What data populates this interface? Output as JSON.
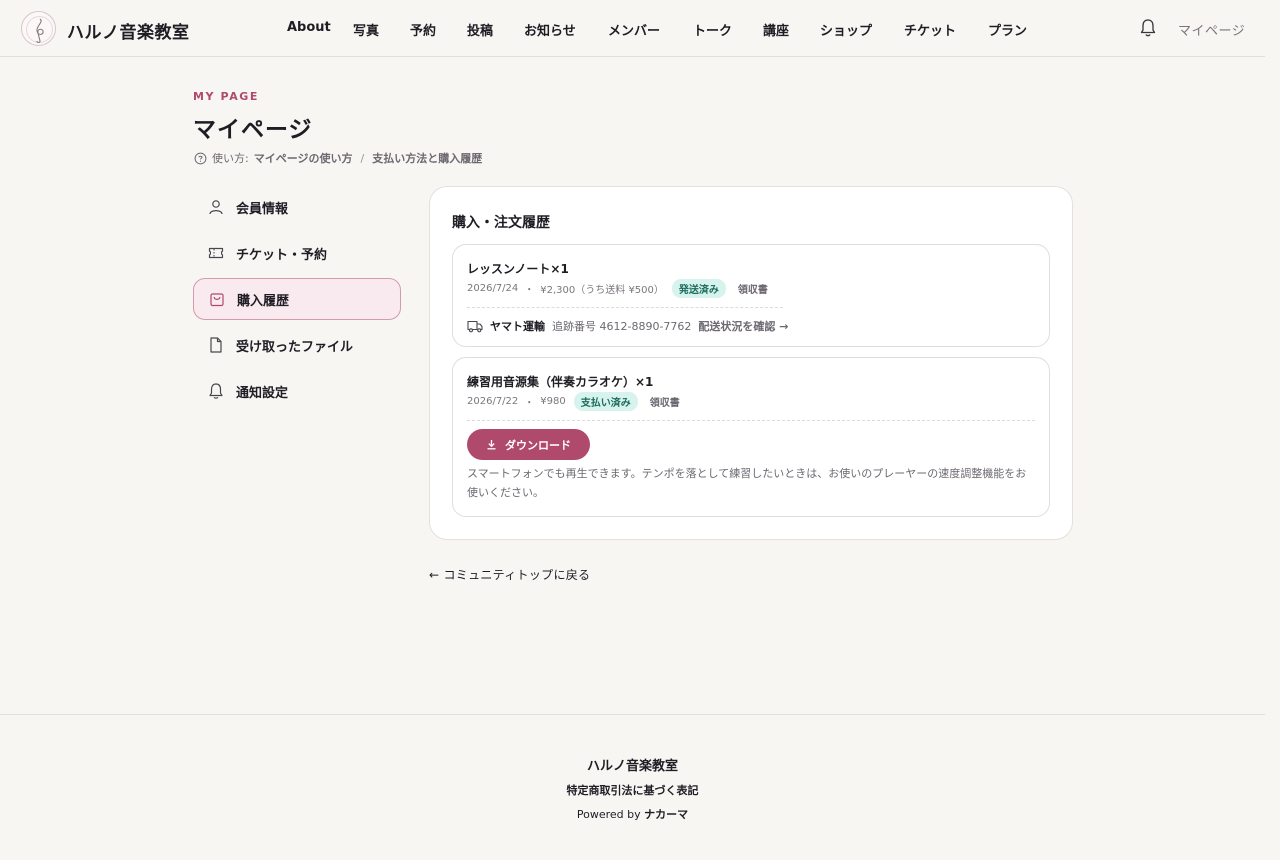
{
  "header": {
    "brand": "ハルノ音楽教室",
    "nav": [
      "About",
      "写真",
      "予約",
      "投稿",
      "お知らせ",
      "メンバー",
      "トーク",
      "講座",
      "ショップ",
      "チケット",
      "プラン"
    ],
    "mypage": "マイページ",
    "icons": {
      "logo": "treble-clef-logo",
      "bell": "bell-icon"
    }
  },
  "page": {
    "eyebrow": "MY PAGE",
    "title": "マイページ",
    "howto_prefix": "使い方:",
    "howto_link1": "マイページの使い方",
    "howto_sep": "/",
    "howto_link2": "支払い方法と購入履歴"
  },
  "sidebar": {
    "items": [
      {
        "label": "会員情報",
        "icon": "user-icon",
        "active": false
      },
      {
        "label": "チケット・予約",
        "icon": "ticket-icon",
        "active": false
      },
      {
        "label": "購入履歴",
        "icon": "bag-icon",
        "active": true
      },
      {
        "label": "受け取ったファイル",
        "icon": "file-icon",
        "active": false
      },
      {
        "label": "通知設定",
        "icon": "bell-icon",
        "active": false
      }
    ]
  },
  "orders_section": {
    "title": "購入・注文履歴",
    "orders": [
      {
        "title": "レッスンノート×1",
        "date": "2026/7/24",
        "dot": "・",
        "price": "¥2,300（うち送料 ¥500）",
        "status": "発送済み",
        "receipt": "領収書",
        "carrier": "ヤマト運輸",
        "tracking": "追跡番号 4612-8890-7762",
        "check_status": "配送状況を確認 →"
      },
      {
        "title": "練習用音源集（伴奏カラオケ）×1",
        "date": "2026/7/22",
        "dot": "・",
        "price": "¥980",
        "status": "支払い済み",
        "receipt": "領収書",
        "download": "ダウンロード",
        "note": "スマートフォンでも再生できます。テンポを落として練習したいときは、お使いのプレーヤーの速度調整機能をお使いください。"
      }
    ]
  },
  "back_link": "← コミュニティトップに戻る",
  "footer": {
    "brand": "ハルノ音楽教室",
    "law": "特定商取引法に基づく表記",
    "powered_prefix": "Powered by",
    "powered_brand": "ナカーマ"
  },
  "colors": {
    "accent": "#b04a6d",
    "background": "#f8f6f3",
    "badge_bg": "#d7f3ee",
    "badge_text": "#1a6b5b",
    "active_bg": "#f8eaef"
  }
}
